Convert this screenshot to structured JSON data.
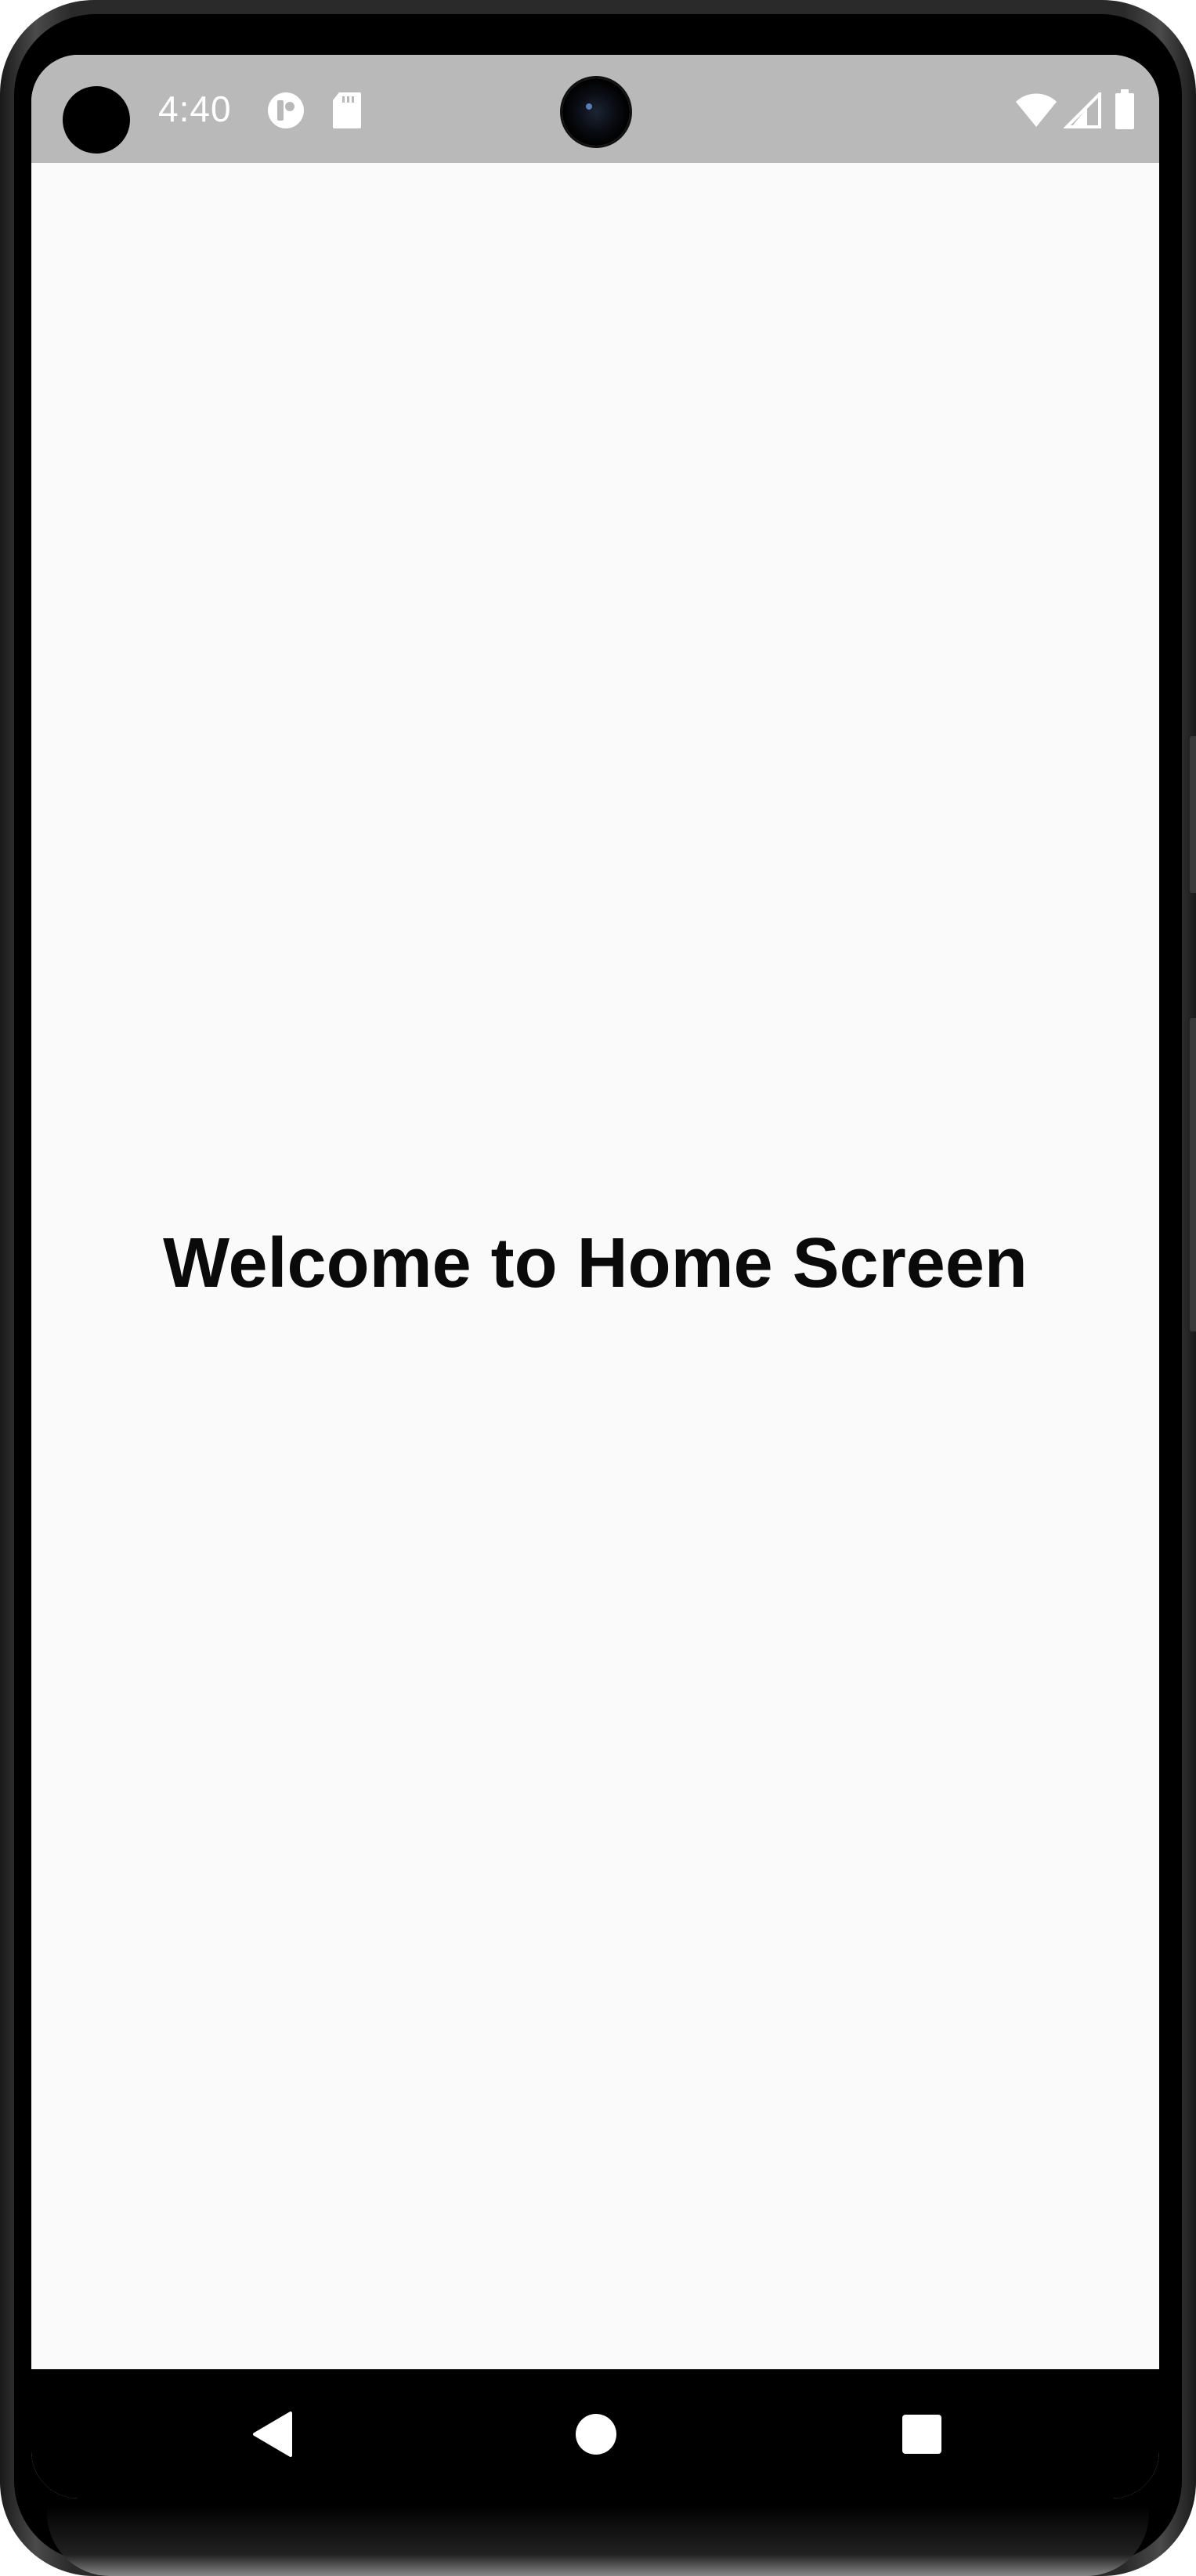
{
  "status_bar": {
    "time": "4:40",
    "icons": [
      "notification-app-icon",
      "sd-card-icon",
      "wifi-icon",
      "cell-signal-icon",
      "battery-icon"
    ]
  },
  "main": {
    "welcome_text": "Welcome to Home Screen"
  },
  "nav_bar": {
    "buttons": [
      "back-icon",
      "home-icon",
      "recents-icon"
    ]
  },
  "colors": {
    "status_bar_bg": "#b9b9b9",
    "screen_bg": "#fafafa",
    "nav_bar_bg": "#000000",
    "text": "#0a0a0a"
  }
}
